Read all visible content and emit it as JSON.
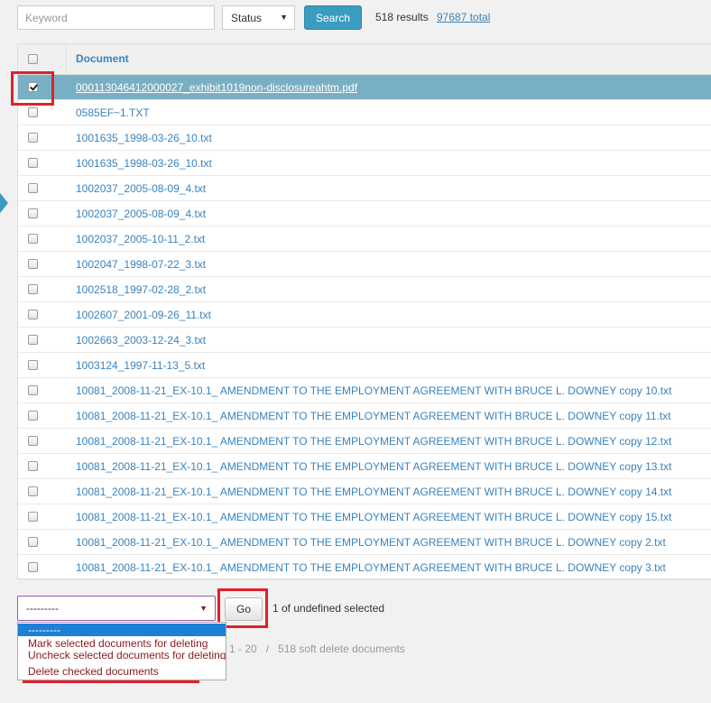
{
  "toolbar": {
    "keyword_placeholder": "Keyword",
    "status_label": "Status",
    "search_label": "Search",
    "results_text": "518 results",
    "total_link": "97687 total"
  },
  "table": {
    "column_header": "Document",
    "rows": [
      {
        "name": "000113046412000027_exhibit1019non-disclosureahtm.pdf",
        "checked": true
      },
      {
        "name": "0585EF~1.TXT",
        "checked": false
      },
      {
        "name": "1001635_1998-03-26_10.txt",
        "checked": false
      },
      {
        "name": "1001635_1998-03-26_10.txt",
        "checked": false
      },
      {
        "name": "1002037_2005-08-09_4.txt",
        "checked": false
      },
      {
        "name": "1002037_2005-08-09_4.txt",
        "checked": false
      },
      {
        "name": "1002037_2005-10-11_2.txt",
        "checked": false
      },
      {
        "name": "1002047_1998-07-22_3.txt",
        "checked": false
      },
      {
        "name": "1002518_1997-02-28_2.txt",
        "checked": false
      },
      {
        "name": "1002607_2001-09-26_11.txt",
        "checked": false
      },
      {
        "name": "1002663_2003-12-24_3.txt",
        "checked": false
      },
      {
        "name": "1003124_1997-11-13_5.txt",
        "checked": false
      },
      {
        "name": "10081_2008-11-21_EX-10.1_ AMENDMENT TO THE EMPLOYMENT AGREEMENT WITH BRUCE L. DOWNEY copy 10.txt",
        "checked": false
      },
      {
        "name": "10081_2008-11-21_EX-10.1_ AMENDMENT TO THE EMPLOYMENT AGREEMENT WITH BRUCE L. DOWNEY copy 11.txt",
        "checked": false
      },
      {
        "name": "10081_2008-11-21_EX-10.1_ AMENDMENT TO THE EMPLOYMENT AGREEMENT WITH BRUCE L. DOWNEY copy 12.txt",
        "checked": false
      },
      {
        "name": "10081_2008-11-21_EX-10.1_ AMENDMENT TO THE EMPLOYMENT AGREEMENT WITH BRUCE L. DOWNEY copy 13.txt",
        "checked": false
      },
      {
        "name": "10081_2008-11-21_EX-10.1_ AMENDMENT TO THE EMPLOYMENT AGREEMENT WITH BRUCE L. DOWNEY copy 14.txt",
        "checked": false
      },
      {
        "name": "10081_2008-11-21_EX-10.1_ AMENDMENT TO THE EMPLOYMENT AGREEMENT WITH BRUCE L. DOWNEY copy 15.txt",
        "checked": false
      },
      {
        "name": "10081_2008-11-21_EX-10.1_ AMENDMENT TO THE EMPLOYMENT AGREEMENT WITH BRUCE L. DOWNEY copy 2.txt",
        "checked": false
      },
      {
        "name": "10081_2008-11-21_EX-10.1_ AMENDMENT TO THE EMPLOYMENT AGREEMENT WITH BRUCE L. DOWNEY copy 3.txt",
        "checked": false
      }
    ]
  },
  "actions": {
    "selected_value": "---------",
    "go_label": "Go",
    "selected_count": "1 of undefined selected",
    "options": [
      "---------",
      "Mark selected documents for deleting",
      "Uncheck selected documents for deleting",
      "Delete checked documents"
    ]
  },
  "pager": {
    "range": "1 - 20",
    "soft_delete": "518 soft delete documents"
  },
  "colors": {
    "accent": "#3a9cbf",
    "link": "#3a83bd",
    "selected_row": "#79afc4",
    "highlight_box": "#e2202a",
    "option_text": "#8b1a1a",
    "option_highlight": "#1e7fd8"
  }
}
